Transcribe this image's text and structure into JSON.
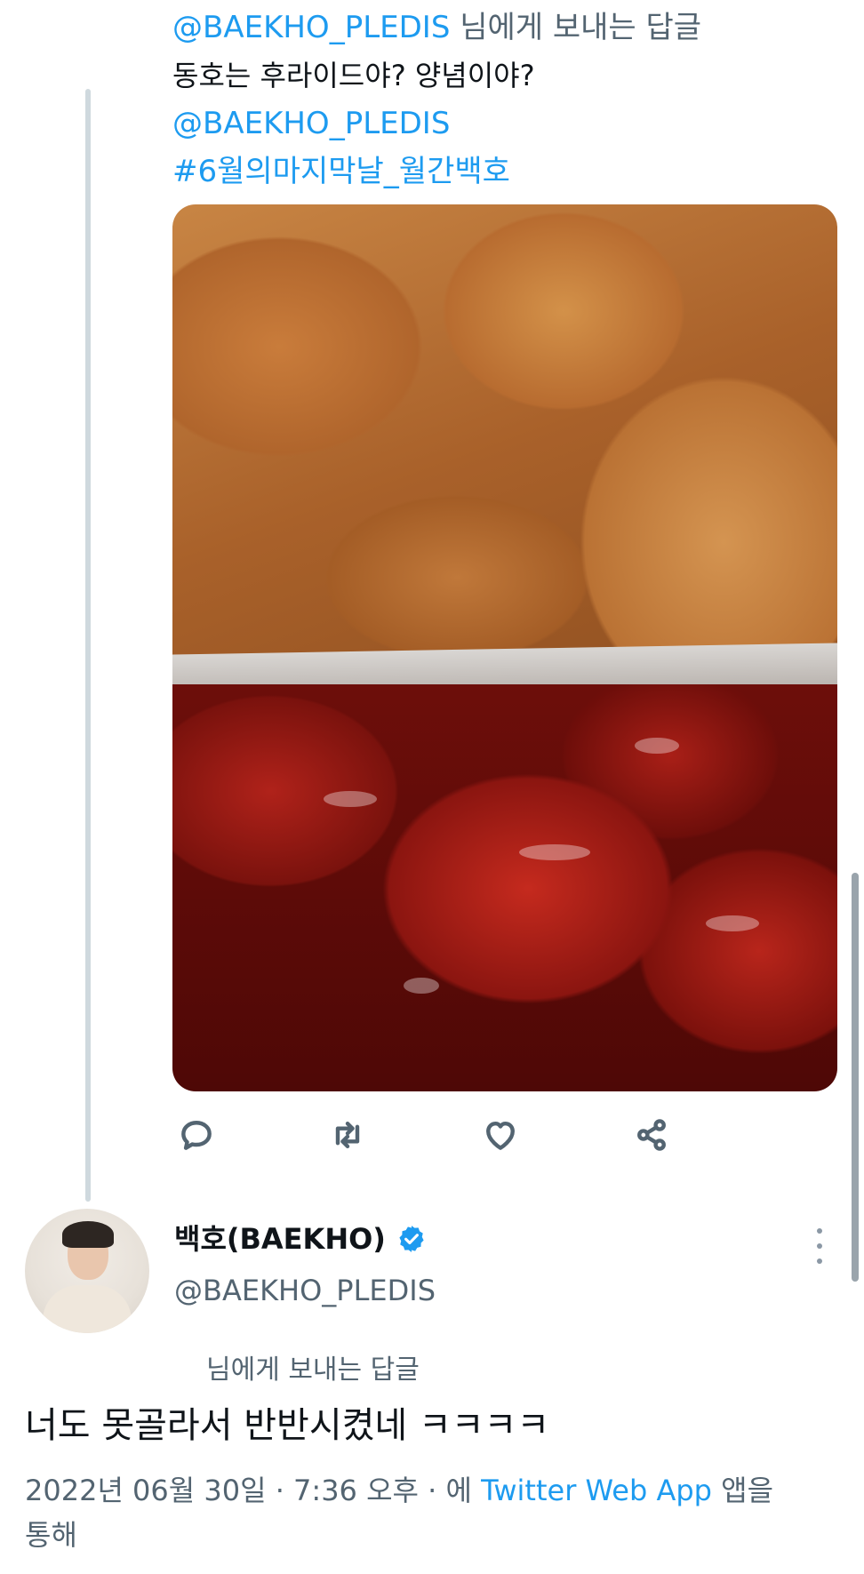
{
  "quoted_reply": {
    "reply_to_handle": "@BAEKHO_PLEDIS",
    "reply_to_suffix": " 님에게 보내는 답글",
    "text": "동호는 후라이드야? 양념이야?",
    "mention": "@BAEKHO_PLEDIS",
    "hashtag": "#6월의마지막날_월간백호"
  },
  "actions": {
    "reply_icon": "reply-icon",
    "retweet_icon": "retweet-icon",
    "like_icon": "heart-icon",
    "share_icon": "share-icon"
  },
  "main_tweet": {
    "display_name": "백호(BAEKHO)",
    "handle": "@BAEKHO_PLEDIS",
    "reply_note": "님에게 보내는 답글",
    "text": "너도 못골라서 반반시켰네 ㅋㅋㅋㅋ",
    "date": "2022년 06월 30일 · 7:36 오후 · 에 ",
    "source": "Twitter Web App",
    "source_suffix": " 앱을",
    "date_line2": "통해"
  },
  "colors": {
    "link": "#1d9bf0",
    "secondary_text": "#536471",
    "verified_badge": "#1d9bf0"
  }
}
